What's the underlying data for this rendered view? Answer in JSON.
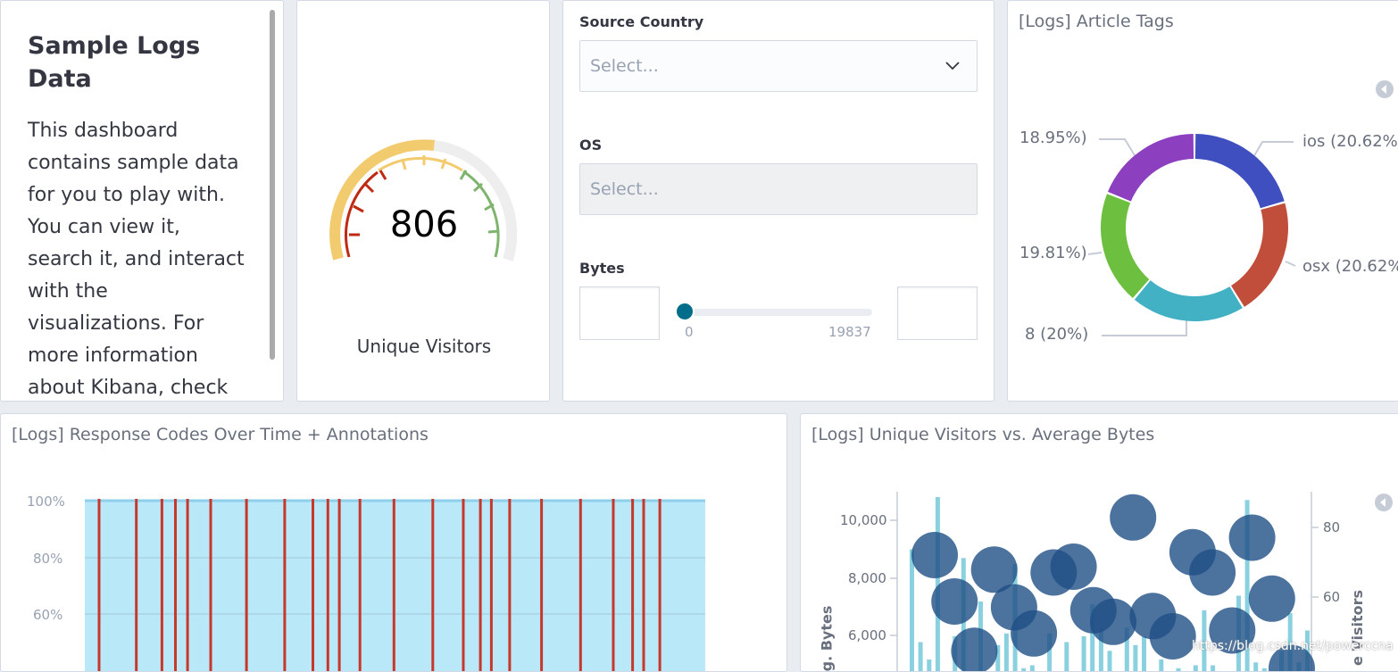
{
  "markdown": {
    "title": "Sample Logs Data",
    "text": "This dashboard contains sample data for you to play with. You can view it, search it, and interact with the visualizations. For more information about Kibana, check"
  },
  "gauge": {
    "value": "806",
    "label": "Unique Visitors"
  },
  "controls": {
    "source_country_label": "Source Country",
    "source_country_placeholder": "Select...",
    "os_label": "OS",
    "os_placeholder": "Select...",
    "bytes_label": "Bytes",
    "range_min": "0",
    "range_max": "19837"
  },
  "tags_panel": {
    "title": "[Logs] Article Tags",
    "labels": [
      "ios (20.62%",
      "osx (20.62%",
      "8 (20%)",
      "19.81%)",
      "18.95%)"
    ],
    "colors": [
      "#3f4fbf",
      "#c14e3a",
      "#42b1c4",
      "#6dbf3f",
      "#8c3fbf"
    ]
  },
  "response_panel": {
    "title": "[Logs] Response Codes Over Time + Annotations",
    "y_ticks": [
      "100%",
      "80%",
      "60%"
    ]
  },
  "visitors_panel": {
    "title": "[Logs] Unique Visitors vs. Average Bytes",
    "left_ticks": [
      "10,000",
      "8,000",
      "6,000"
    ],
    "right_ticks": [
      "80",
      "60"
    ],
    "left_axis_label": "g. Bytes",
    "right_axis_label": "e Visitors"
  },
  "watermark": "https://blog.csdn.net/powerccna",
  "chart_data": [
    {
      "type": "pie",
      "title": "[Logs] Article Tags",
      "categories": [
        "ios",
        "osx",
        "8",
        "",
        ""
      ],
      "values": [
        20.62,
        20.62,
        20,
        19.81,
        18.95
      ],
      "colors": [
        "#3f4fbf",
        "#c14e3a",
        "#42b1c4",
        "#6dbf3f",
        "#8c3fbf"
      ]
    },
    {
      "type": "area",
      "title": "[Logs] Response Codes Over Time + Annotations",
      "ylim": [
        0,
        100
      ],
      "y_ticks": [
        "100%",
        "80%",
        "60%"
      ],
      "values": [
        100
      ],
      "annotation_count": 24
    },
    {
      "type": "scatter",
      "title": "[Logs] Unique Visitors vs. Average Bytes",
      "ylim": [
        4000,
        11000
      ],
      "y2lim": [
        40,
        90
      ],
      "bar_values": [
        9000,
        5800,
        5200,
        10800,
        4800,
        6000,
        8700,
        4300,
        7200,
        4400,
        5700,
        6100,
        8500,
        4900,
        5000,
        4500,
        6100,
        4800,
        5800,
        4700,
        6000,
        7100,
        6300,
        5500,
        4700,
        6300,
        5700,
        6000,
        4700,
        5200,
        4800,
        4900,
        4400,
        5000,
        6900,
        5000,
        4300,
        4700,
        7400,
        10700,
        5100,
        4900,
        4800,
        5500,
        6800,
        5100,
        6200
      ],
      "bubbles": [
        {
          "x": 1,
          "y": 8800
        },
        {
          "x": 2,
          "y": 7200
        },
        {
          "x": 3,
          "y": 5500
        },
        {
          "x": 4,
          "y": 8300
        },
        {
          "x": 5,
          "y": 7000
        },
        {
          "x": 6,
          "y": 6100
        },
        {
          "x": 7,
          "y": 8200
        },
        {
          "x": 8,
          "y": 8400
        },
        {
          "x": 9,
          "y": 6900
        },
        {
          "x": 10,
          "y": 6500
        },
        {
          "x": 11,
          "y": 10100
        },
        {
          "x": 12,
          "y": 6700
        },
        {
          "x": 13,
          "y": 6000
        },
        {
          "x": 14,
          "y": 8900
        },
        {
          "x": 15,
          "y": 8200
        },
        {
          "x": 16,
          "y": 6200
        },
        {
          "x": 17,
          "y": 9400
        },
        {
          "x": 18,
          "y": 7300
        },
        {
          "x": 19,
          "y": 4900
        }
      ]
    }
  ]
}
